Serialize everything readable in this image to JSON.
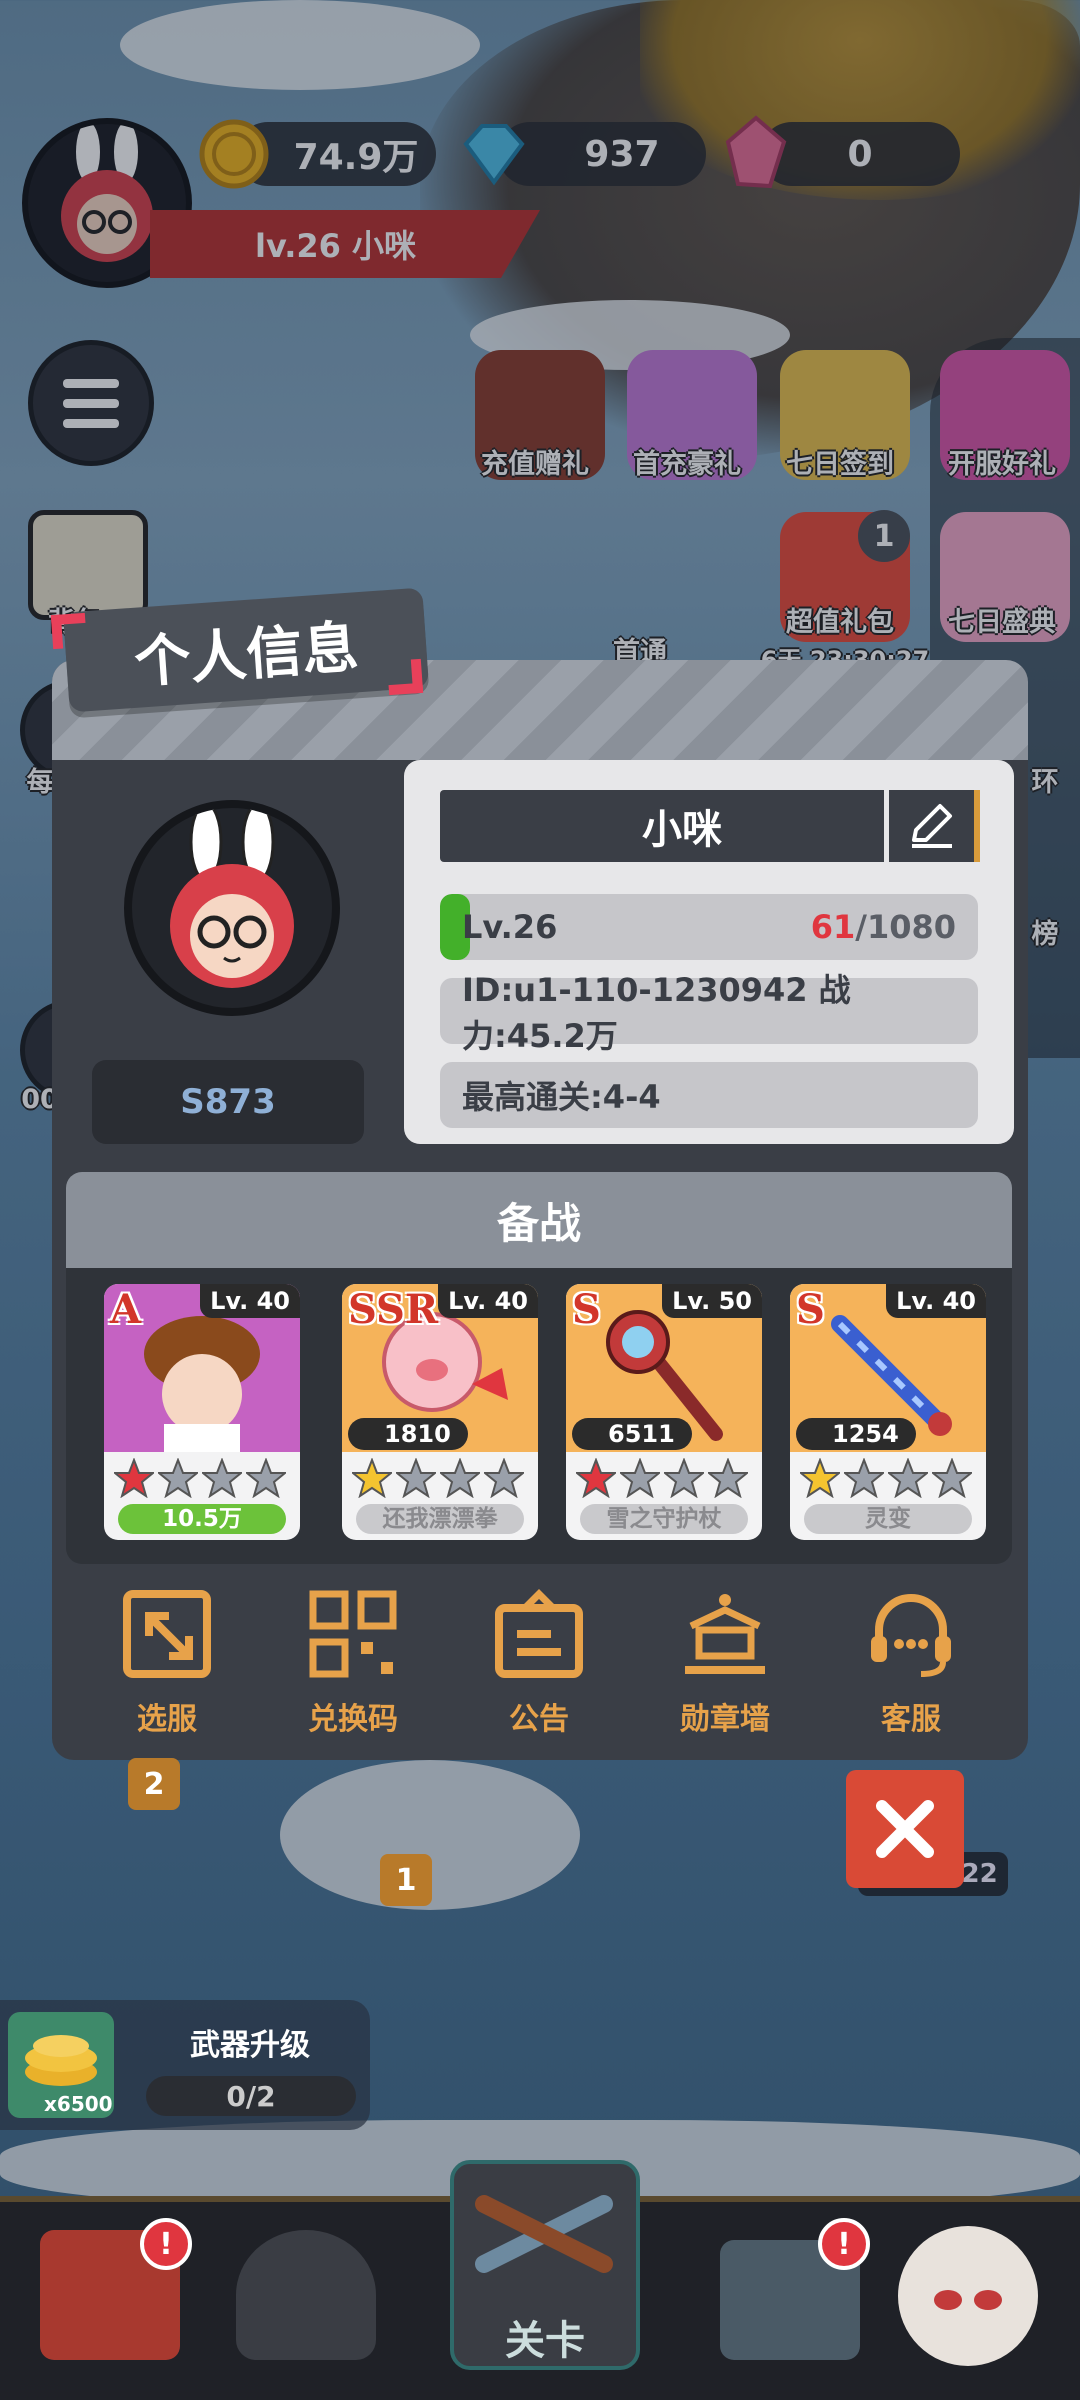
{
  "hud": {
    "level_name": "lv.26  小咪",
    "coins": "74.9万",
    "diamonds": "937",
    "crystals": "0"
  },
  "events": [
    {
      "label": "充值赠礼"
    },
    {
      "label": "首充豪礼"
    },
    {
      "label": "七日签到"
    },
    {
      "label": "开服好礼"
    },
    {
      "label": "超值礼包",
      "badge": "1",
      "timer": "6天 23:30:27"
    },
    {
      "label": "七日盛典"
    }
  ],
  "background_text": {
    "side_label_1": "背包",
    "side_label_2": "每",
    "side_label_3": "00",
    "first_pass": "首通",
    "rank_partial": "榜",
    "ring_partial": "环",
    "marker_2": "2",
    "marker_1": "1",
    "timer_right": "00:26:22"
  },
  "modal": {
    "title": "个人信息",
    "server": "S873",
    "player_name": "小咪",
    "level": "Lv.26",
    "exp_current": "61",
    "exp_total": "/1080",
    "exp_fraction": 0.056,
    "id_power": "ID:u1-110-1230942 战力:45.2万",
    "best_stage": "最高通关:4-4",
    "roster_title": "备战",
    "cards": [
      {
        "rarity": "A",
        "level": "Lv. 40",
        "name": "10.5万",
        "power": "",
        "stars": 1,
        "star_color": "#e0363f",
        "bg": "#c562c2",
        "name_bg": "#6cc23a",
        "name_color": "#ffffff"
      },
      {
        "rarity": "SSR",
        "level": "Lv. 40",
        "name": "还我漂漂拳",
        "power": "1810",
        "stars": 1,
        "star_color": "#f4c430",
        "bg": "#f5b35a",
        "name_bg": "#c9c9cc",
        "name_color": "#8a8a8e"
      },
      {
        "rarity": "S",
        "level": "Lv. 50",
        "name": "雪之守护杖",
        "power": "6511",
        "stars": 1,
        "star_color": "#e0363f",
        "bg": "#f5b35a",
        "name_bg": "#c9c9cc",
        "name_color": "#8a8a8e"
      },
      {
        "rarity": "S",
        "level": "Lv. 40",
        "name": "灵变",
        "power": "1254",
        "stars": 1,
        "star_color": "#f4c430",
        "bg": "#f5b35a",
        "name_bg": "#c9c9cc",
        "name_color": "#8a8a8e"
      }
    ],
    "actions": [
      {
        "label": "选服",
        "icon": "server-select-icon"
      },
      {
        "label": "兑换码",
        "icon": "qr-code-icon"
      },
      {
        "label": "公告",
        "icon": "announcement-icon"
      },
      {
        "label": "勋章墙",
        "icon": "medal-wall-icon"
      },
      {
        "label": "客服",
        "icon": "headset-icon"
      }
    ]
  },
  "weapon_upgrade": {
    "title": "武器升级",
    "progress": "0/2",
    "reward": "x6500"
  },
  "bottom_nav": {
    "center_label": "关卡"
  },
  "colors": {
    "accent_orange": "#e7a24a",
    "level_green": "#43b02a",
    "exp_red": "#e0363f",
    "close_red": "#d94a36"
  }
}
